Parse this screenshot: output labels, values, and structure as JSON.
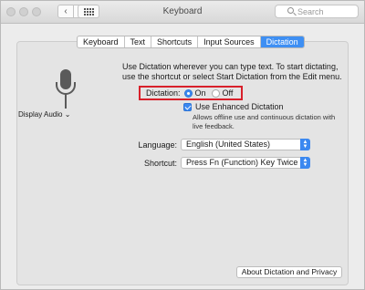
{
  "window": {
    "title": "Keyboard",
    "search_placeholder": "Search"
  },
  "tabs": [
    {
      "label": "Keyboard",
      "active": false
    },
    {
      "label": "Text",
      "active": false
    },
    {
      "label": "Shortcuts",
      "active": false
    },
    {
      "label": "Input Sources",
      "active": false
    },
    {
      "label": "Dictation",
      "active": true
    }
  ],
  "sidebar": {
    "device_label": "Display Audio ⌄",
    "icon": "microphone-icon"
  },
  "dictation": {
    "description": "Use Dictation wherever you can type text. To start dictating, use the shortcut or select Start Dictation from the Edit menu.",
    "label": "Dictation:",
    "on_label": "On",
    "off_label": "Off",
    "selected": "On",
    "enhanced_label": "Use Enhanced Dictation",
    "enhanced_checked": true,
    "enhanced_help": "Allows offline use and continuous dictation with live feedback."
  },
  "language": {
    "label": "Language:",
    "value": "English (United States)"
  },
  "shortcut": {
    "label": "Shortcut:",
    "value": "Press Fn (Function) Key Twice"
  },
  "about_button": "About Dictation and Privacy",
  "colors": {
    "accent": "#3b88f0",
    "highlight_border": "#d8202a"
  }
}
